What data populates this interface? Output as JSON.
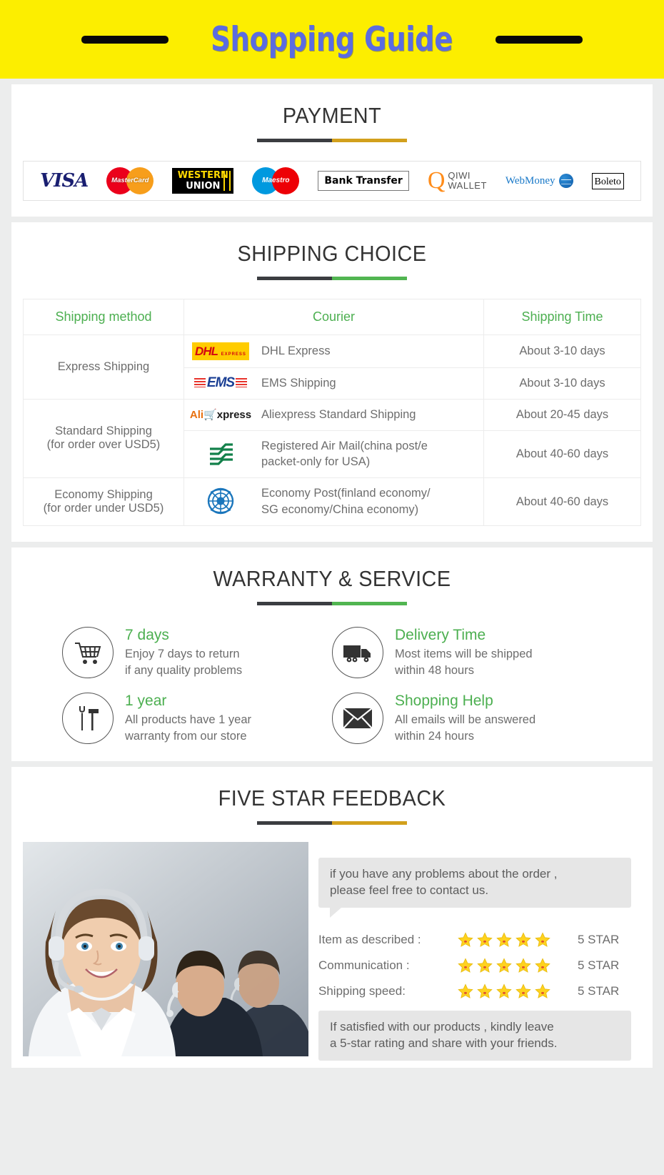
{
  "header": {
    "title": "Shopping Guide"
  },
  "payment": {
    "title": "PAYMENT",
    "logos": [
      {
        "name": "visa-logo",
        "text": "VISA"
      },
      {
        "name": "mastercard-logo",
        "text": "MasterCard"
      },
      {
        "name": "western-union-logo",
        "line1": "WESTERN",
        "line2": "UNION"
      },
      {
        "name": "maestro-logo",
        "text": "Maestro"
      },
      {
        "name": "bank-transfer-logo",
        "text": "Bank Transfer"
      },
      {
        "name": "qiwi-wallet-logo",
        "mark": "Q",
        "line1": "QIWI",
        "line2": "WALLET"
      },
      {
        "name": "webmoney-logo",
        "text": "WebMoney"
      },
      {
        "name": "boleto-logo",
        "text": "Boleto"
      }
    ]
  },
  "shipping": {
    "title": "SHIPPING CHOICE",
    "columns": [
      "Shipping method",
      "Courier",
      "Shipping Time"
    ],
    "rows": [
      {
        "method": "Express Shipping",
        "logo": "dhl-logo",
        "courier": "DHL Express",
        "time": "About 3-10 days"
      },
      {
        "method": "",
        "logo": "ems-logo",
        "courier": "EMS Shipping",
        "time": "About 3-10 days"
      },
      {
        "method": "Standard Shipping\n(for order over USD5)",
        "logo": "aliexpress-logo",
        "courier": "Aliexpress Standard Shipping",
        "time": "About 20-45 days"
      },
      {
        "method": "",
        "logo": "china-post-logo",
        "courier": "Registered Air Mail(china post/e packet-only for USA)",
        "time": "About 40-60 days"
      },
      {
        "method": "Economy Shipping\n(for order under USD5)",
        "logo": "un-logo",
        "courier": "Economy Post(finland economy/ SG economy/China economy)",
        "time": "About 40-60 days"
      }
    ],
    "cells": {
      "method_express": "Express Shipping",
      "method_standard_l1": "Standard Shipping",
      "method_standard_l2": "(for order over USD5)",
      "method_economy_l1": "Economy Shipping",
      "method_economy_l2": "(for order under USD5)",
      "courier_dhl": "DHL Express",
      "courier_ems": "EMS Shipping",
      "courier_ali": "Aliexpress Standard Shipping",
      "courier_ram_l1": "Registered Air Mail(china post/e",
      "courier_ram_l2": "packet-only for USA)",
      "courier_eco_l1": "Economy Post(finland economy/",
      "courier_eco_l2": "SG economy/China economy)",
      "time_dhl": "About 3-10 days",
      "time_ems": "About 3-10 days",
      "time_ali": "About 20-45 days",
      "time_ram": "About 40-60 days",
      "time_eco": "About 40-60 days"
    },
    "logo_text": {
      "dhl_main": "DHL",
      "dhl_sub": "EXPRESS",
      "ems": "EMS",
      "ali_a": "Ali",
      "ali_x": "xpress"
    }
  },
  "warranty": {
    "title": "WARRANTY & SERVICE",
    "items": [
      {
        "icon": "shopping-cart-icon",
        "title": "7 days",
        "line1": "Enjoy 7 days to return",
        "line2": "if any quality problems"
      },
      {
        "icon": "truck-icon",
        "title": "Delivery Time",
        "line1": "Most items will be shipped",
        "line2": "within 48 hours"
      },
      {
        "icon": "tools-icon",
        "title": "1 year",
        "line1": "All products have 1 year",
        "line2": "warranty from our store"
      },
      {
        "icon": "envelope-icon",
        "title": "Shopping Help",
        "line1": "All emails will be answered",
        "line2": "within 24 hours"
      }
    ]
  },
  "feedback": {
    "title": "FIVE STAR FEEDBACK",
    "bubble_top_l1": "if you have any problems about the order ,",
    "bubble_top_l2": "please feel free to contact us.",
    "ratings": [
      {
        "label": "Item as described :",
        "stars": 5,
        "value": "5 STAR"
      },
      {
        "label": "Communication :",
        "stars": 5,
        "value": "5 STAR"
      },
      {
        "label": "Shipping speed:",
        "stars": 5,
        "value": "5 STAR"
      }
    ],
    "rating_rows": {
      "r0_label": "Item as described :",
      "r0_value": "5 STAR",
      "r1_label": "Communication :",
      "r1_value": "5 STAR",
      "r2_label": "Shipping speed:",
      "r2_value": "5 STAR"
    },
    "bubble_bottom_l1": "If satisfied with our products ,  kindly leave",
    "bubble_bottom_l2": "a 5-star rating and share with your friends."
  },
  "colors": {
    "header_bg": "#fcee00",
    "header_text": "#5b6ce0",
    "green": "#4caf50",
    "gold": "#d2a01c",
    "dark": "#3b3d41",
    "star": "#ffd21e"
  }
}
